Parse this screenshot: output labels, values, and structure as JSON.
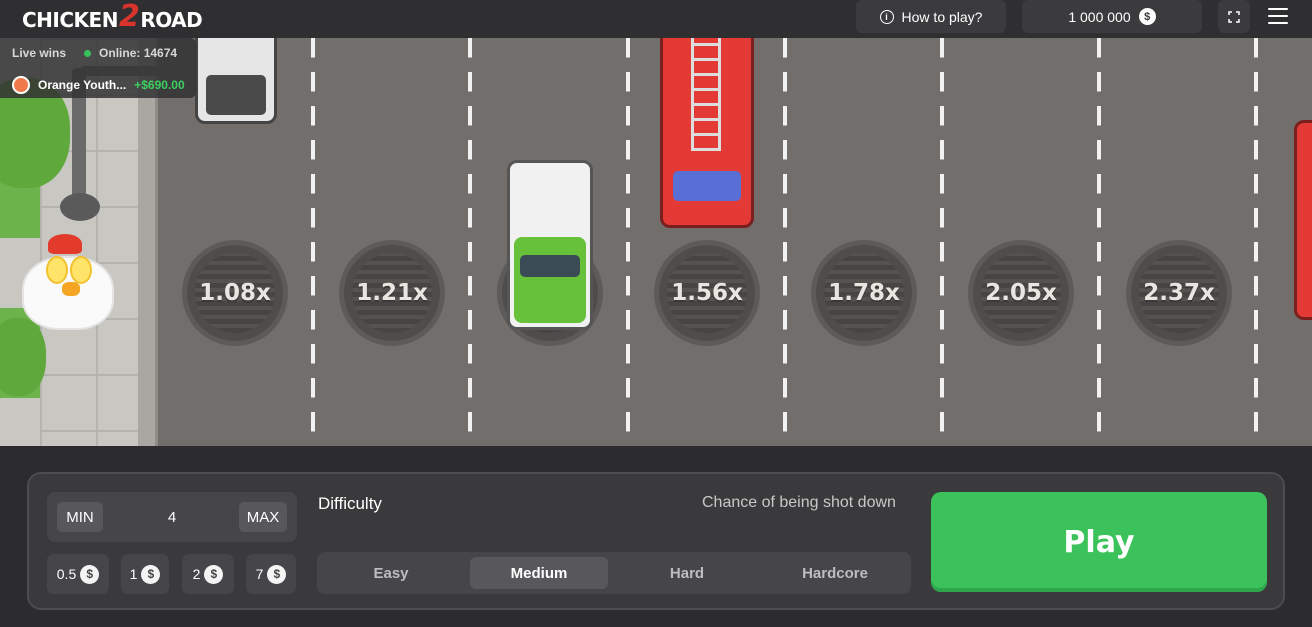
{
  "header": {
    "logo": {
      "left": "CHICKEN",
      "mid": "2",
      "right": "ROAD"
    },
    "how_to_play": "How to play?",
    "balance": "1 000 000",
    "currency_symbol": "$"
  },
  "live_wins": {
    "label": "Live wins",
    "online": "Online: 14674",
    "latest": {
      "name": "Orange Youth...",
      "amount": "+$690.00"
    }
  },
  "multipliers": [
    "1.08x",
    "1.21x",
    "1.56x",
    "1.78x",
    "2.05x",
    "2.37x"
  ],
  "bet": {
    "min_label": "MIN",
    "max_label": "MAX",
    "value": "4",
    "quick_amounts": [
      "0.5",
      "1",
      "2",
      "7"
    ]
  },
  "difficulty": {
    "label": "Difficulty",
    "chance_label": "Chance of being shot down",
    "options": [
      "Easy",
      "Medium",
      "Hard",
      "Hardcore"
    ],
    "selected": "Medium"
  },
  "play_button": "Play",
  "colors": {
    "accent": "#3cc25a",
    "online_dot": "#39c25a",
    "logo_two": "#d9342b"
  }
}
